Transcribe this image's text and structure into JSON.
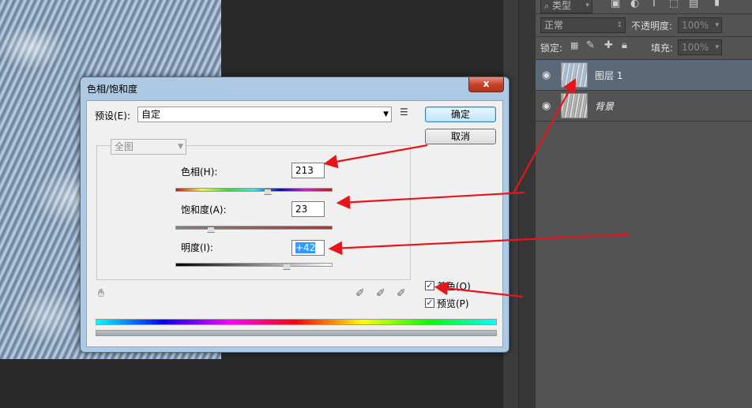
{
  "layers_panel": {
    "filter_label": "类型",
    "blend_mode": "正常",
    "opacity_label": "不透明度:",
    "opacity_value": "100%",
    "lock_label": "锁定:",
    "fill_label": "填充:",
    "fill_value": "100%",
    "layers": [
      {
        "name": "图层 1",
        "active": true
      },
      {
        "name": "背景",
        "active": false
      }
    ]
  },
  "dialog": {
    "title": "色相/饱和度",
    "close_symbol": "x",
    "preset_label": "预设(E):",
    "preset_value": "自定",
    "ok_label": "确定",
    "cancel_label": "取消",
    "channel_value": "全图",
    "hue_label": "色相(H):",
    "hue_value": "213",
    "saturation_label": "饱和度(A):",
    "saturation_value": "23",
    "lightness_label": "明度(I):",
    "lightness_value": "+42",
    "colorize_label": "着色(O)",
    "colorize_checked": true,
    "preview_label": "预览(P)",
    "preview_checked": true
  },
  "colors": {
    "annotation_arrow": "#e8141b",
    "panel_bg": "#535353",
    "active_layer": "#5b6878"
  }
}
